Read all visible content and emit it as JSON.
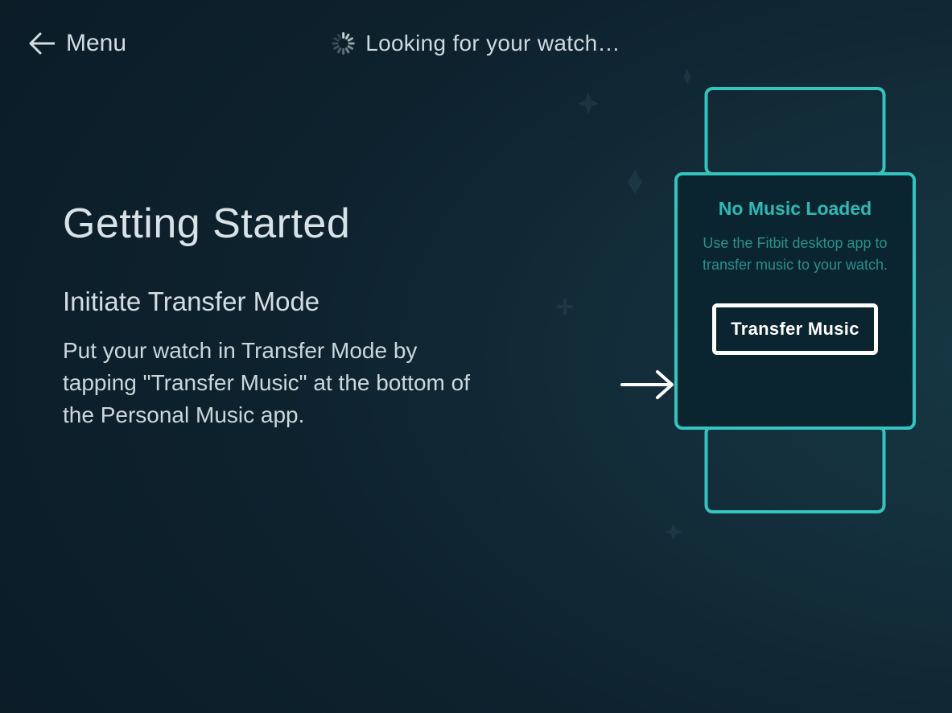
{
  "topbar": {
    "menu_label": "Menu",
    "status_text": "Looking for your watch…"
  },
  "main": {
    "heading": "Getting Started",
    "subheading": "Initiate Transfer Mode",
    "body": "Put your watch in Transfer Mode by tapping \"Transfer Music\" at the bottom of the Personal Music app."
  },
  "watch": {
    "title": "No Music Loaded",
    "subtitle": "Use the Fitbit desktop app to transfer music to your watch.",
    "button_label": "Transfer Music"
  },
  "colors": {
    "accent": "#34c4c0",
    "bg_dark": "#0a1a25"
  }
}
